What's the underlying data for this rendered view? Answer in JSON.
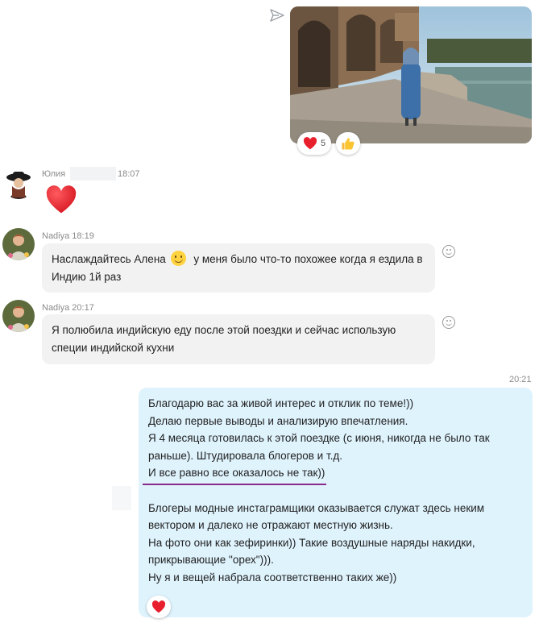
{
  "photo_message": {
    "reactions": [
      {
        "icon": "heart-icon",
        "count": "5"
      },
      {
        "icon": "thumbs-up-icon"
      }
    ]
  },
  "messages": [
    {
      "sender": "Юлия",
      "time": "18:07",
      "type": "emoji",
      "emoji": "heart-icon"
    },
    {
      "sender_time": "Nadiya 18:19",
      "text_part1": "Наслаждайтесь Алена",
      "text_part2": "у меня было что-то похожее когда я ездила в",
      "text_line2": "Индию 1й раз"
    },
    {
      "sender_time": "Nadiya 20:17",
      "line1": "Я полюбила индийскую еду после этой поездки и сейчас использую",
      "line2": "специи индийской кухни"
    }
  ],
  "outgoing": {
    "time": "20:21",
    "lines": [
      "Благодарю вас за живой интерес и отклик по теме!))",
      "Делаю первые выводы и анализирую впечатления.",
      "Я 4 месяца готовилась к этой поездке (с июня, никогда не было так",
      "раньше). Штудировала блогеров и т.д.",
      "И все равно все оказалось не так))",
      "",
      "Блогеры модные инстаграмщики оказывается служат здесь неким",
      "вектором и далеко не отражают местную жизнь.",
      "На фото они как зефиринки)) Такие воздушные наряды накидки,",
      "прикрывающие \"орех\"))).",
      "Ну я и вещей набрала соответственно таких же))"
    ],
    "reaction": "heart-icon"
  },
  "colors": {
    "outgoing_bubble": "#dff3fd",
    "incoming_bubble": "#f2f2f2",
    "heart": "#e8202d",
    "underline": "#8b2a8a"
  }
}
